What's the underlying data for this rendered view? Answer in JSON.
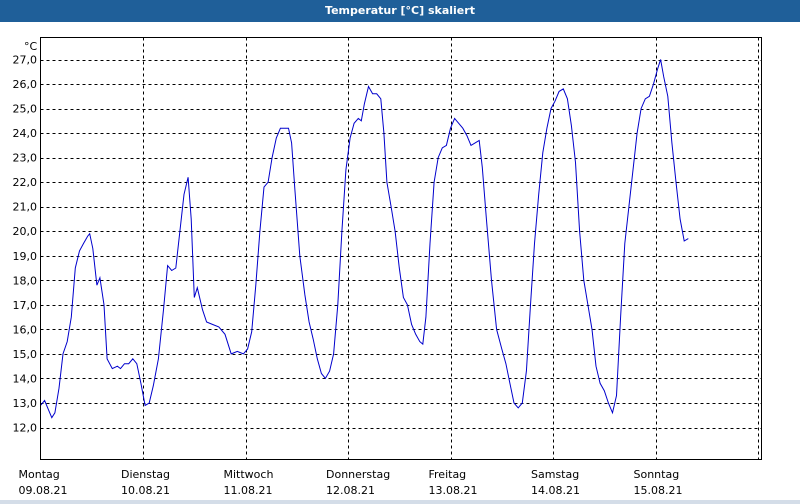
{
  "window": {
    "title": "Temperatur [°C] skaliert"
  },
  "colors": {
    "title_bar": "#1f5f99",
    "line": "#0000cc",
    "grid": "#000000"
  },
  "chart_data": {
    "type": "line",
    "title": "Temperatur [°C] skaliert",
    "ylabel": "°C",
    "ylim": [
      12.0,
      27.0
    ],
    "yticks": [
      "12,0",
      "13,0",
      "14,0",
      "15,0",
      "16,0",
      "17,0",
      "18,0",
      "19,0",
      "20,0",
      "21,0",
      "22,0",
      "23,0",
      "24,0",
      "25,0",
      "26,0",
      "27,0"
    ],
    "xlim_days": [
      0,
      7.14
    ],
    "x_ticks": [
      {
        "day": "Montag",
        "date": "09.08.21"
      },
      {
        "day": "Dienstag",
        "date": "10.08.21"
      },
      {
        "day": "Mittwoch",
        "date": "11.08.21"
      },
      {
        "day": "Donnerstag",
        "date": "12.08.21"
      },
      {
        "day": "Freitag",
        "date": "13.08.21"
      },
      {
        "day": "Samstag",
        "date": "14.08.21"
      },
      {
        "day": "Sonntag",
        "date": "15.08.21"
      }
    ],
    "grid": true,
    "series": [
      {
        "values": [
          [
            0.0,
            12.9
          ],
          [
            0.04,
            13.1
          ],
          [
            0.08,
            12.7
          ],
          [
            0.11,
            12.4
          ],
          [
            0.14,
            12.6
          ],
          [
            0.18,
            13.6
          ],
          [
            0.22,
            15.0
          ],
          [
            0.26,
            15.5
          ],
          [
            0.3,
            16.5
          ],
          [
            0.34,
            18.5
          ],
          [
            0.38,
            19.2
          ],
          [
            0.42,
            19.5
          ],
          [
            0.46,
            19.8
          ],
          [
            0.48,
            19.9
          ],
          [
            0.51,
            19.3
          ],
          [
            0.55,
            17.8
          ],
          [
            0.58,
            18.1
          ],
          [
            0.62,
            17.0
          ],
          [
            0.65,
            14.8
          ],
          [
            0.7,
            14.4
          ],
          [
            0.75,
            14.5
          ],
          [
            0.78,
            14.4
          ],
          [
            0.82,
            14.6
          ],
          [
            0.86,
            14.6
          ],
          [
            0.9,
            14.8
          ],
          [
            0.94,
            14.6
          ],
          [
            0.98,
            13.8
          ],
          [
            1.02,
            12.9
          ],
          [
            1.06,
            13.0
          ],
          [
            1.1,
            13.7
          ],
          [
            1.15,
            14.8
          ],
          [
            1.2,
            16.8
          ],
          [
            1.24,
            18.6
          ],
          [
            1.28,
            18.4
          ],
          [
            1.32,
            18.5
          ],
          [
            1.36,
            20.0
          ],
          [
            1.4,
            21.5
          ],
          [
            1.44,
            22.2
          ],
          [
            1.47,
            20.5
          ],
          [
            1.5,
            17.3
          ],
          [
            1.53,
            17.7
          ],
          [
            1.58,
            16.8
          ],
          [
            1.62,
            16.3
          ],
          [
            1.68,
            16.2
          ],
          [
            1.74,
            16.1
          ],
          [
            1.8,
            15.8
          ],
          [
            1.86,
            15.0
          ],
          [
            1.92,
            15.1
          ],
          [
            1.98,
            15.0
          ],
          [
            2.02,
            15.2
          ],
          [
            2.06,
            15.9
          ],
          [
            2.1,
            17.8
          ],
          [
            2.14,
            20.0
          ],
          [
            2.18,
            21.8
          ],
          [
            2.22,
            22.0
          ],
          [
            2.26,
            23.0
          ],
          [
            2.3,
            23.8
          ],
          [
            2.34,
            24.2
          ],
          [
            2.38,
            24.2
          ],
          [
            2.42,
            24.2
          ],
          [
            2.45,
            23.6
          ],
          [
            2.48,
            21.8
          ],
          [
            2.53,
            19.0
          ],
          [
            2.58,
            17.4
          ],
          [
            2.62,
            16.3
          ],
          [
            2.66,
            15.6
          ],
          [
            2.7,
            14.8
          ],
          [
            2.74,
            14.2
          ],
          [
            2.78,
            14.0
          ],
          [
            2.82,
            14.3
          ],
          [
            2.86,
            15.0
          ],
          [
            2.9,
            17.0
          ],
          [
            2.94,
            20.0
          ],
          [
            2.98,
            22.5
          ],
          [
            3.02,
            23.8
          ],
          [
            3.06,
            24.4
          ],
          [
            3.1,
            24.6
          ],
          [
            3.13,
            24.5
          ],
          [
            3.16,
            25.2
          ],
          [
            3.2,
            25.9
          ],
          [
            3.24,
            25.6
          ],
          [
            3.28,
            25.6
          ],
          [
            3.32,
            25.4
          ],
          [
            3.35,
            24.0
          ],
          [
            3.38,
            22.0
          ],
          [
            3.42,
            21.0
          ],
          [
            3.46,
            20.0
          ],
          [
            3.5,
            18.5
          ],
          [
            3.54,
            17.3
          ],
          [
            3.58,
            17.0
          ],
          [
            3.62,
            16.2
          ],
          [
            3.66,
            15.8
          ],
          [
            3.7,
            15.5
          ],
          [
            3.73,
            15.4
          ],
          [
            3.76,
            16.5
          ],
          [
            3.8,
            19.5
          ],
          [
            3.84,
            22.0
          ],
          [
            3.88,
            23.0
          ],
          [
            3.92,
            23.4
          ],
          [
            3.96,
            23.5
          ],
          [
            4.0,
            24.2
          ],
          [
            4.04,
            24.6
          ],
          [
            4.08,
            24.4
          ],
          [
            4.12,
            24.2
          ],
          [
            4.16,
            23.9
          ],
          [
            4.2,
            23.5
          ],
          [
            4.24,
            23.6
          ],
          [
            4.28,
            23.7
          ],
          [
            4.31,
            22.6
          ],
          [
            4.35,
            20.5
          ],
          [
            4.4,
            18.0
          ],
          [
            4.45,
            16.0
          ],
          [
            4.5,
            15.2
          ],
          [
            4.54,
            14.6
          ],
          [
            4.58,
            13.8
          ],
          [
            4.62,
            13.0
          ],
          [
            4.66,
            12.8
          ],
          [
            4.7,
            13.0
          ],
          [
            4.74,
            14.3
          ],
          [
            4.78,
            17.0
          ],
          [
            4.82,
            19.5
          ],
          [
            4.86,
            21.5
          ],
          [
            4.9,
            23.2
          ],
          [
            4.94,
            24.2
          ],
          [
            4.98,
            25.0
          ],
          [
            5.02,
            25.3
          ],
          [
            5.06,
            25.7
          ],
          [
            5.1,
            25.8
          ],
          [
            5.14,
            25.4
          ],
          [
            5.18,
            24.3
          ],
          [
            5.22,
            22.8
          ],
          [
            5.26,
            20.0
          ],
          [
            5.3,
            18.0
          ],
          [
            5.34,
            17.0
          ],
          [
            5.38,
            16.0
          ],
          [
            5.42,
            14.5
          ],
          [
            5.46,
            13.8
          ],
          [
            5.5,
            13.5
          ],
          [
            5.54,
            13.0
          ],
          [
            5.58,
            12.6
          ],
          [
            5.62,
            13.3
          ],
          [
            5.66,
            16.5
          ],
          [
            5.7,
            19.5
          ],
          [
            5.74,
            21.0
          ],
          [
            5.78,
            22.5
          ],
          [
            5.82,
            24.0
          ],
          [
            5.86,
            25.0
          ],
          [
            5.9,
            25.4
          ],
          [
            5.94,
            25.5
          ],
          [
            5.98,
            26.0
          ],
          [
            6.02,
            26.6
          ],
          [
            6.05,
            27.0
          ],
          [
            6.08,
            26.3
          ],
          [
            6.12,
            25.5
          ],
          [
            6.16,
            23.6
          ],
          [
            6.2,
            22.0
          ],
          [
            6.24,
            20.5
          ],
          [
            6.28,
            19.6
          ],
          [
            6.32,
            19.7
          ]
        ]
      }
    ]
  }
}
